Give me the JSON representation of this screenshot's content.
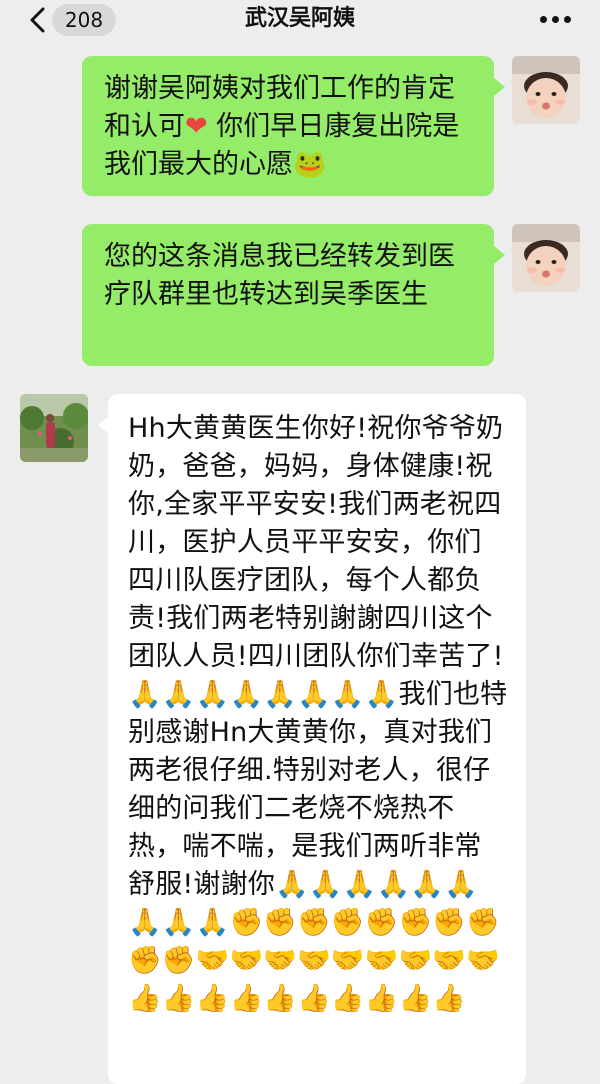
{
  "nav": {
    "back_count": "208",
    "title": "武汉吴阿姨"
  },
  "messages": [
    {
      "from": "me",
      "text_before_heart": "谢谢吴阿姨对我们工作的肯定和认可",
      "heart": "❤",
      "text_after_heart": " 你们早日康复出院是我们最大的心愿",
      "trailing_emoji": "🐸"
    },
    {
      "from": "me",
      "text": "您的这条消息我已经转发到医疗队群里也转达到吴季医生"
    },
    {
      "from": "other",
      "text": "Hh大黄黄医生你好!祝你爷爷奶奶，爸爸，妈妈，身体健康!祝你,全家平平安安!我们两老祝四川，医护人员平平安安，你们四川队医疗团队，每个人都负责!我们两老特别謝謝四川这个团队人员!四川团队你们幸苦了!🙏🙏🙏🙏🙏🙏🙏🙏我们也特别感谢Hn大黄黄你，真对我们两老很仔细.特别对老人，很仔细的问我们二老烧不烧热不热，喘不喘，是我们两听非常舒服!谢謝你🙏🙏🙏🙏🙏🙏🙏🙏🙏✊✊✊✊✊✊✊✊✊✊🤝🤝🤝🤝🤝🤝🤝🤝🤝👍👍👍👍👍👍👍👍👍👍"
    }
  ],
  "colors": {
    "background": "#ededed",
    "my_bubble": "#95ec69",
    "other_bubble": "#ffffff"
  },
  "icons": {
    "back": "chevron-left-icon",
    "more": "more-dots-icon"
  }
}
